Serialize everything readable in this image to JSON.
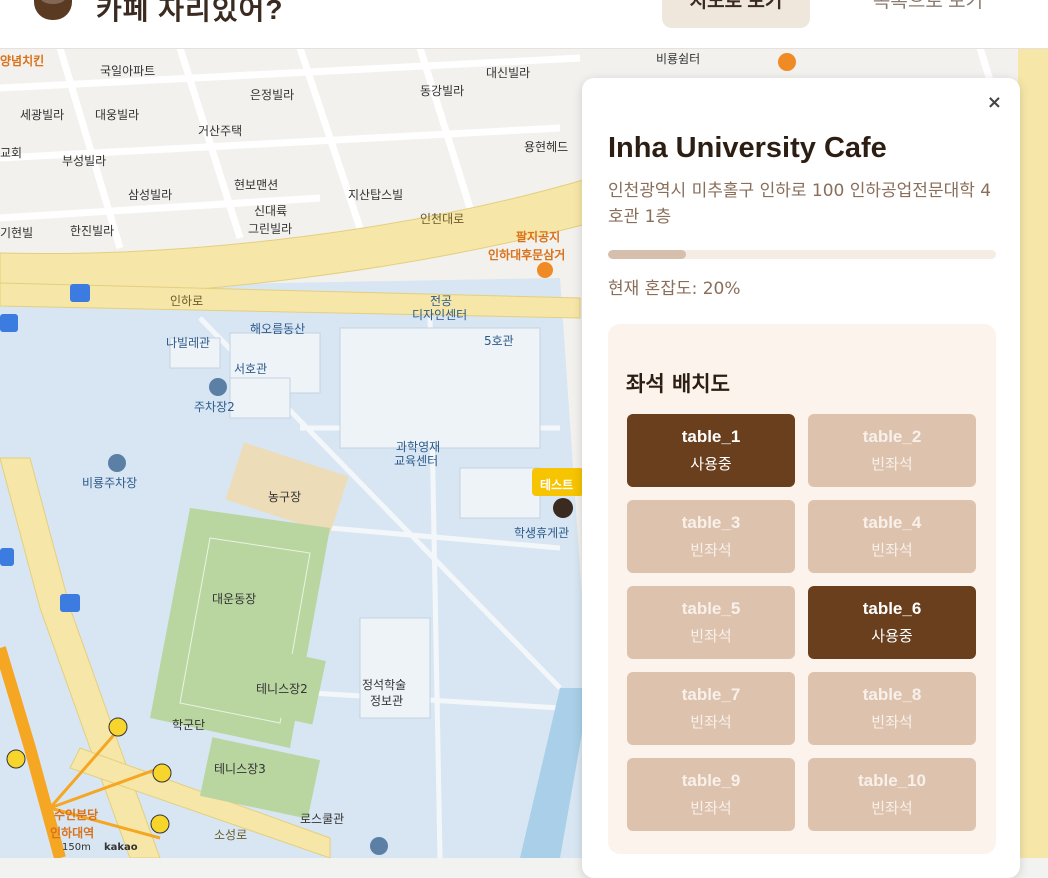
{
  "header": {
    "title": "카페 자리있어?",
    "btn_map": "지도로 보기",
    "btn_list": "목록으로 보기",
    "logo_icon": "coffee-cup-icon"
  },
  "map": {
    "labels": [
      "양념치킨",
      "국일아파트",
      "세광빌라",
      "대웅빌라",
      "은정빌라",
      "동강빌라",
      "대신빌라",
      "비룡쉼터",
      "교회",
      "부성빌라",
      "거산주택",
      "용현헤드",
      "삼성빌라",
      "현보맨션",
      "지산탑스빌",
      "신대륙",
      "그린빌라",
      "기현빌",
      "한진빌라",
      "인천대로",
      "팔지공지",
      "인하대후문삼거",
      "인하로",
      "해오름동산",
      "나빌레관",
      "전공",
      "디자인센터",
      "5호관",
      "서호관",
      "주차장2",
      "과학영재",
      "교육센터",
      "테스트",
      "학생휴게관",
      "비룡주차장",
      "농구장",
      "대운동장",
      "테니스장2",
      "정석학술",
      "정보관",
      "학군단",
      "테니스장3",
      "로스쿨관",
      "소성로",
      "수인분당",
      "인하대역",
      "150m",
      "kakao"
    ],
    "colors": {
      "campus": "#d8e6f3",
      "main_road": "#f6e7a8",
      "field": "#b9d6a0",
      "subway": "#f5a623"
    }
  },
  "panel": {
    "close_label": "×",
    "cafe_name": "Inha University Cafe",
    "address": "인천광역시 미추홀구 인하로 100 인하공업전문대학 4호관 1층",
    "congestion_label": "현재 혼잡도: 20%",
    "congestion_fraction": 0.2,
    "seat_title": "좌석 배치도",
    "tables": [
      {
        "name": "table_1",
        "status": "사용중",
        "used": true
      },
      {
        "name": "table_2",
        "status": "빈좌석",
        "used": false
      },
      {
        "name": "table_3",
        "status": "빈좌석",
        "used": false
      },
      {
        "name": "table_4",
        "status": "빈좌석",
        "used": false
      },
      {
        "name": "table_5",
        "status": "빈좌석",
        "used": false
      },
      {
        "name": "table_6",
        "status": "사용중",
        "used": true
      },
      {
        "name": "table_7",
        "status": "빈좌석",
        "used": false
      },
      {
        "name": "table_8",
        "status": "빈좌석",
        "used": false
      },
      {
        "name": "table_9",
        "status": "빈좌석",
        "used": false
      },
      {
        "name": "table_10",
        "status": "빈좌석",
        "used": false
      }
    ],
    "colors": {
      "used": "#6a3f1d",
      "free": "#ddc2ad"
    }
  }
}
